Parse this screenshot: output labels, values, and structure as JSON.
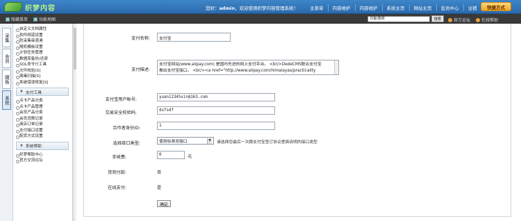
{
  "header": {
    "logo_text": "织梦内容",
    "greeting_prefix": "您好：",
    "username": "admin",
    "greeting_suffix": "，欢迎使用织梦内容管理系统！",
    "nav": [
      "主菜单",
      "内容维护",
      "内容维护",
      "系统主页",
      "网站主页",
      "会员中心",
      "注销"
    ],
    "quick_button": "快捷方式"
  },
  "subbar": {
    "left": [
      "隐藏菜单",
      "功能地图"
    ],
    "search_value": "功能搜索",
    "search_button": "搜索",
    "right": [
      "官方论坛",
      "在线帮助"
    ]
  },
  "sidetabs": [
    "采集",
    "会员",
    "模板",
    "系统"
  ],
  "menu": {
    "top_items": [
      "自定义文档属性",
      "软件频道设置",
      "防采集串混淆",
      "随机模板设置",
      "计划任务管理",
      "数据库备份/还原",
      "SQL命令行工具",
      "文件校验[S]",
      "病毒扫描[S]",
      "系统错误修复[S]"
    ],
    "section1_title": "支付工具",
    "section1_items": [
      "点卡产品分类",
      "点卡产品管理",
      "会员产品分类",
      "会员消费记录",
      "商店订单记录",
      "支付接口设置",
      "配货方式设置"
    ],
    "section2_title": "系统帮助",
    "section2_items": [
      "织梦帮助中心",
      "官方交流论坛"
    ]
  },
  "form": {
    "name_label": "支付名称:",
    "name_value": "支付宝",
    "desc_label": "支付描述:",
    "desc_line1": "支付宝网站(www.alipay.com) 是国内先进的网上支付平台。 <br/>DedeCMS联合支付宝",
    "desc_line2": "推出支付宝接口。 <br/><a href=\"http://www.alipay.com/himalayas/practicality",
    "account_label": "支付宝用户帐号:",
    "account_value": "yuan12345xin@163.com",
    "key_label": "交易安全校验码:",
    "key_value": "dsfsdf",
    "partner_label": "合作者身份ID:",
    "partner_value": "1",
    "type_label": "选择接口类型:",
    "type_value": "使用标准双接口",
    "type_hint": "请选择您最后一次跟支付宝签订协议里面说明的接口类型",
    "fee_label": "手续费:",
    "fee_value": "0",
    "fee_unit": "元",
    "cod_label": "货到付款:",
    "cod_value": "否",
    "online_label": "在线支付:",
    "online_value": "是",
    "submit_label": "确定"
  }
}
